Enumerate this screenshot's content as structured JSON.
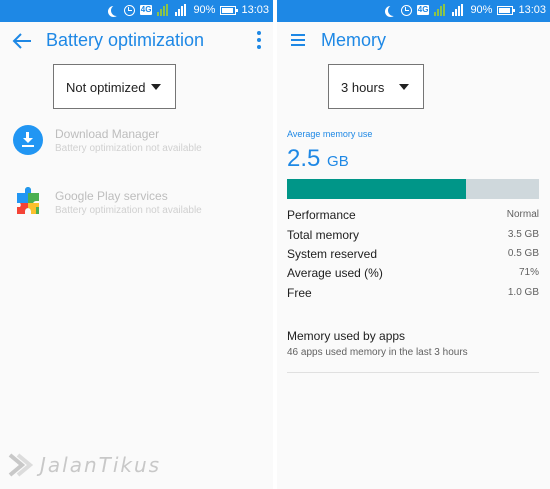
{
  "status_bar": {
    "network_badge": "4G",
    "battery_percent": "90%",
    "time": "13:03"
  },
  "left_screen": {
    "title": "Battery optimization",
    "dropdown": {
      "selected": "Not optimized"
    },
    "apps": [
      {
        "name": "Download Manager",
        "status": "Battery optimization not available",
        "icon": "download-icon"
      },
      {
        "name": "Google Play services",
        "status": "Battery optimization not available",
        "icon": "puzzle-icon"
      }
    ]
  },
  "right_screen": {
    "title": "Memory",
    "dropdown": {
      "selected": "3 hours"
    },
    "average_label": "Average memory use",
    "average_value": "2.5",
    "average_unit": "GB",
    "usage_fraction": 0.71,
    "stats": [
      {
        "name": "Performance",
        "value": "Normal"
      },
      {
        "name": "Total memory",
        "value": "3.5 GB"
      },
      {
        "name": "System reserved",
        "value": "0.5 GB"
      },
      {
        "name": "Average used (%)",
        "value": "71%"
      },
      {
        "name": "Free",
        "value": "1.0 GB"
      }
    ],
    "apps_section": {
      "title": "Memory used by apps",
      "subtitle": "46 apps used memory in the last 3 hours"
    }
  },
  "watermark": {
    "text": "JalanTikus"
  },
  "colors": {
    "accent": "#1e88e5",
    "bar_fill": "#009688",
    "bar_track": "#cfd8dc",
    "disabled_text": "#bdbdbd"
  }
}
